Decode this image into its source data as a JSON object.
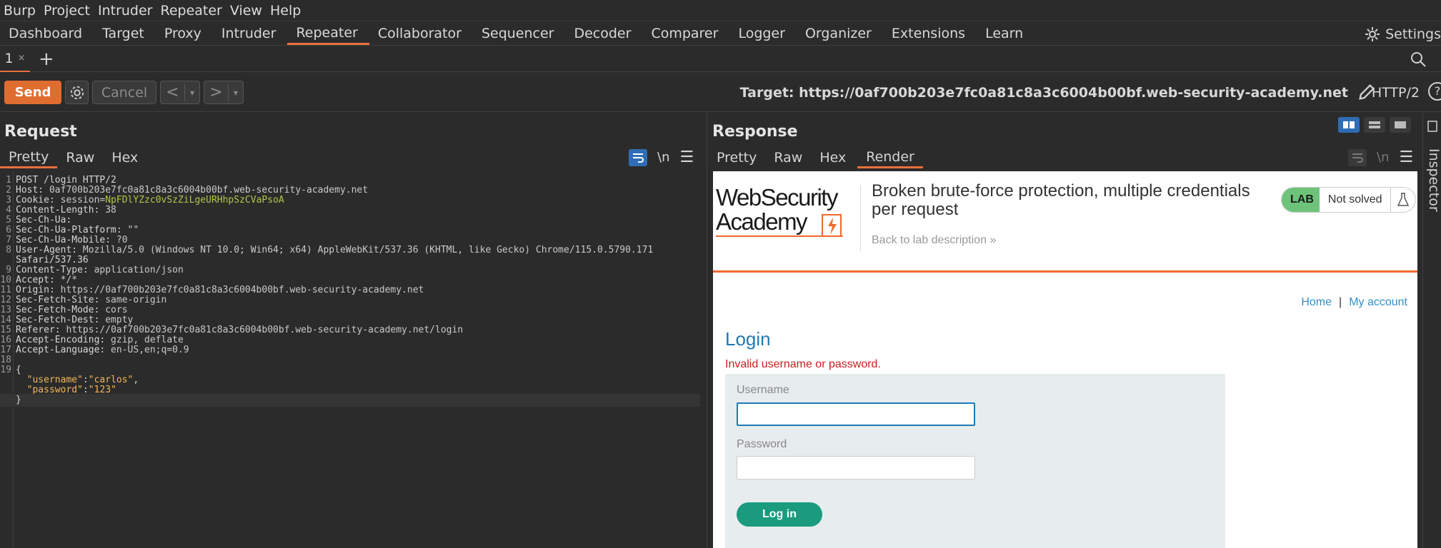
{
  "menubar": [
    "Burp",
    "Project",
    "Intruder",
    "Repeater",
    "View",
    "Help"
  ],
  "tooltabs": [
    "Dashboard",
    "Target",
    "Proxy",
    "Intruder",
    "Repeater",
    "Collaborator",
    "Sequencer",
    "Decoder",
    "Comparer",
    "Logger",
    "Organizer",
    "Extensions",
    "Learn"
  ],
  "active_tool": "Repeater",
  "settings_label": "Settings",
  "subtab": {
    "label": "1",
    "close": "×"
  },
  "toolbar": {
    "send": "Send",
    "cancel": "Cancel",
    "back": "<",
    "forward": ">",
    "dropdown": "▾",
    "target": "Target: https://0af700b203e7fc0a81c8a3c6004b00bf.web-security-academy.net",
    "protocol": "HTTP/2"
  },
  "request": {
    "title": "Request",
    "tabs": [
      "Pretty",
      "Raw",
      "Hex"
    ],
    "active_tab": "Pretty",
    "newline_label": "\\n",
    "lines": [
      {
        "n": "1",
        "text": "POST /login HTTP/2"
      },
      {
        "n": "2",
        "key": "Host:",
        "val": " 0af700b203e7fc0a81c8a3c6004b00bf.web-security-academy.net"
      },
      {
        "n": "3",
        "key": "Cookie:",
        "val": " session=",
        "sess": "NpFDlYZzc0vSzZiLgeURHhpSzCVaPsoA"
      },
      {
        "n": "4",
        "key": "Content-Length:",
        "val": " 38"
      },
      {
        "n": "5",
        "key": "Sec-Ch-Ua:",
        "val": ""
      },
      {
        "n": "6",
        "key": "Sec-Ch-Ua-Platform:",
        "val": " \"\""
      },
      {
        "n": "7",
        "key": "Sec-Ch-Ua-Mobile:",
        "val": " ?0"
      },
      {
        "n": "8",
        "key": "User-Agent:",
        "val": " Mozilla/5.0 (Windows NT 10.0; Win64; x64) AppleWebKit/537.36 (KHTML, like Gecko) Chrome/115.0.5790.171"
      },
      {
        "n": "",
        "text": "Safari/537.36"
      },
      {
        "n": "9",
        "key": "Content-Type:",
        "val": " application/json"
      },
      {
        "n": "10",
        "key": "Accept:",
        "val": " */*"
      },
      {
        "n": "11",
        "key": "Origin:",
        "val": " https://0af700b203e7fc0a81c8a3c6004b00bf.web-security-academy.net"
      },
      {
        "n": "12",
        "key": "Sec-Fetch-Site:",
        "val": " same-origin"
      },
      {
        "n": "13",
        "key": "Sec-Fetch-Mode:",
        "val": " cors"
      },
      {
        "n": "14",
        "key": "Sec-Fetch-Dest:",
        "val": " empty"
      },
      {
        "n": "15",
        "key": "Referer:",
        "val": " https://0af700b203e7fc0a81c8a3c6004b00bf.web-security-academy.net/login"
      },
      {
        "n": "16",
        "key": "Accept-Encoding:",
        "val": " gzip, deflate"
      },
      {
        "n": "17",
        "key": "Accept-Language:",
        "val": " en-US,en;q=0.9"
      },
      {
        "n": "18",
        "text": ""
      },
      {
        "n": "19",
        "text": "{"
      },
      {
        "n": "",
        "jk": "\"username\"",
        "jv": "\"carlos\"",
        "tail": ","
      },
      {
        "n": "",
        "jk": "\"password\"",
        "jv": "\"123\"",
        "tail": ""
      },
      {
        "n": "",
        "text": "}"
      }
    ]
  },
  "response": {
    "title": "Response",
    "tabs": [
      "Pretty",
      "Raw",
      "Hex",
      "Render"
    ],
    "active_tab": "Render",
    "newline_label": "\\n"
  },
  "render": {
    "logo_line1": "WebSecurity",
    "logo_line2": "Academy",
    "lab_title": "Broken brute-force protection, multiple credentials per request",
    "back_link": "Back to lab description",
    "back_chevrons": "»",
    "lab_label": "LAB",
    "status": "Not solved",
    "nav_home": "Home",
    "nav_sep": "|",
    "nav_account": "My account",
    "heading": "Login",
    "error": "Invalid username or password.",
    "username_label": "Username",
    "password_label": "Password",
    "login_button": "Log in"
  },
  "side_panel": "Inspector",
  "colors": {
    "accent": "#e06d30",
    "selected": "#2e6db5",
    "lab_green": "#6ec37b"
  }
}
